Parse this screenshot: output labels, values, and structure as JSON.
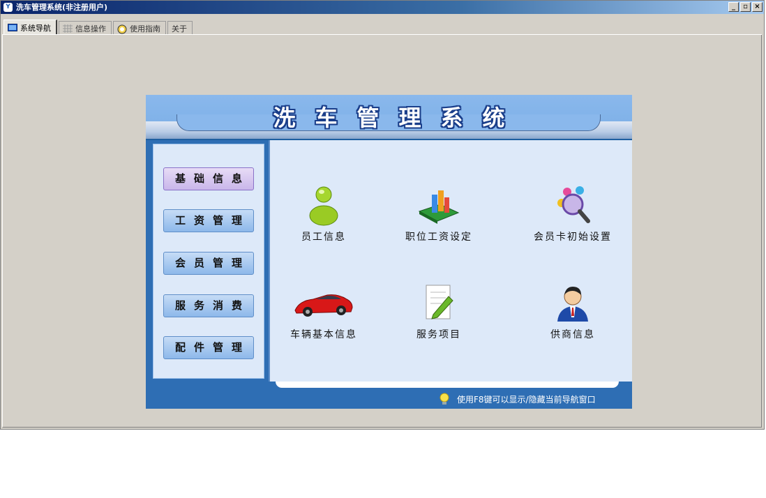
{
  "window": {
    "title": "洗车管理系统(非注册用户)",
    "controls": {
      "minimize": "_",
      "restore": "▫",
      "close": "×"
    }
  },
  "tabs": [
    {
      "label": "系统导航",
      "icon": "monitor-icon",
      "active": true
    },
    {
      "label": "信息操作",
      "icon": "grid-icon",
      "active": false
    },
    {
      "label": "使用指南",
      "icon": "compass-icon",
      "active": false
    },
    {
      "label": "关于",
      "icon": "",
      "active": false
    }
  ],
  "panel": {
    "title": "洗车管理系统",
    "sidebar": [
      {
        "label": "基础信息",
        "active": true
      },
      {
        "label": "工资管理",
        "active": false
      },
      {
        "label": "会员管理",
        "active": false
      },
      {
        "label": "服务消费",
        "active": false
      },
      {
        "label": "配件管理",
        "active": false
      }
    ],
    "items": [
      {
        "label": "员工信息",
        "icon": "employee-icon"
      },
      {
        "label": "职位工资设定",
        "icon": "salary-book-icon"
      },
      {
        "label": "会员卡初始设置",
        "icon": "magnifier-people-icon"
      },
      {
        "label": "车辆基本信息",
        "icon": "red-car-icon"
      },
      {
        "label": "服务项目",
        "icon": "note-pencil-icon"
      },
      {
        "label": "供商信息",
        "icon": "businessman-icon"
      }
    ],
    "footer_tip": "使用F8键可以显示/隐藏当前导航窗口"
  },
  "colors": {
    "titlebar": "#0a246a",
    "panel_blue": "#2e6eb4",
    "panel_light": "#dde9f9",
    "header_blue": "#8ab8ec"
  }
}
